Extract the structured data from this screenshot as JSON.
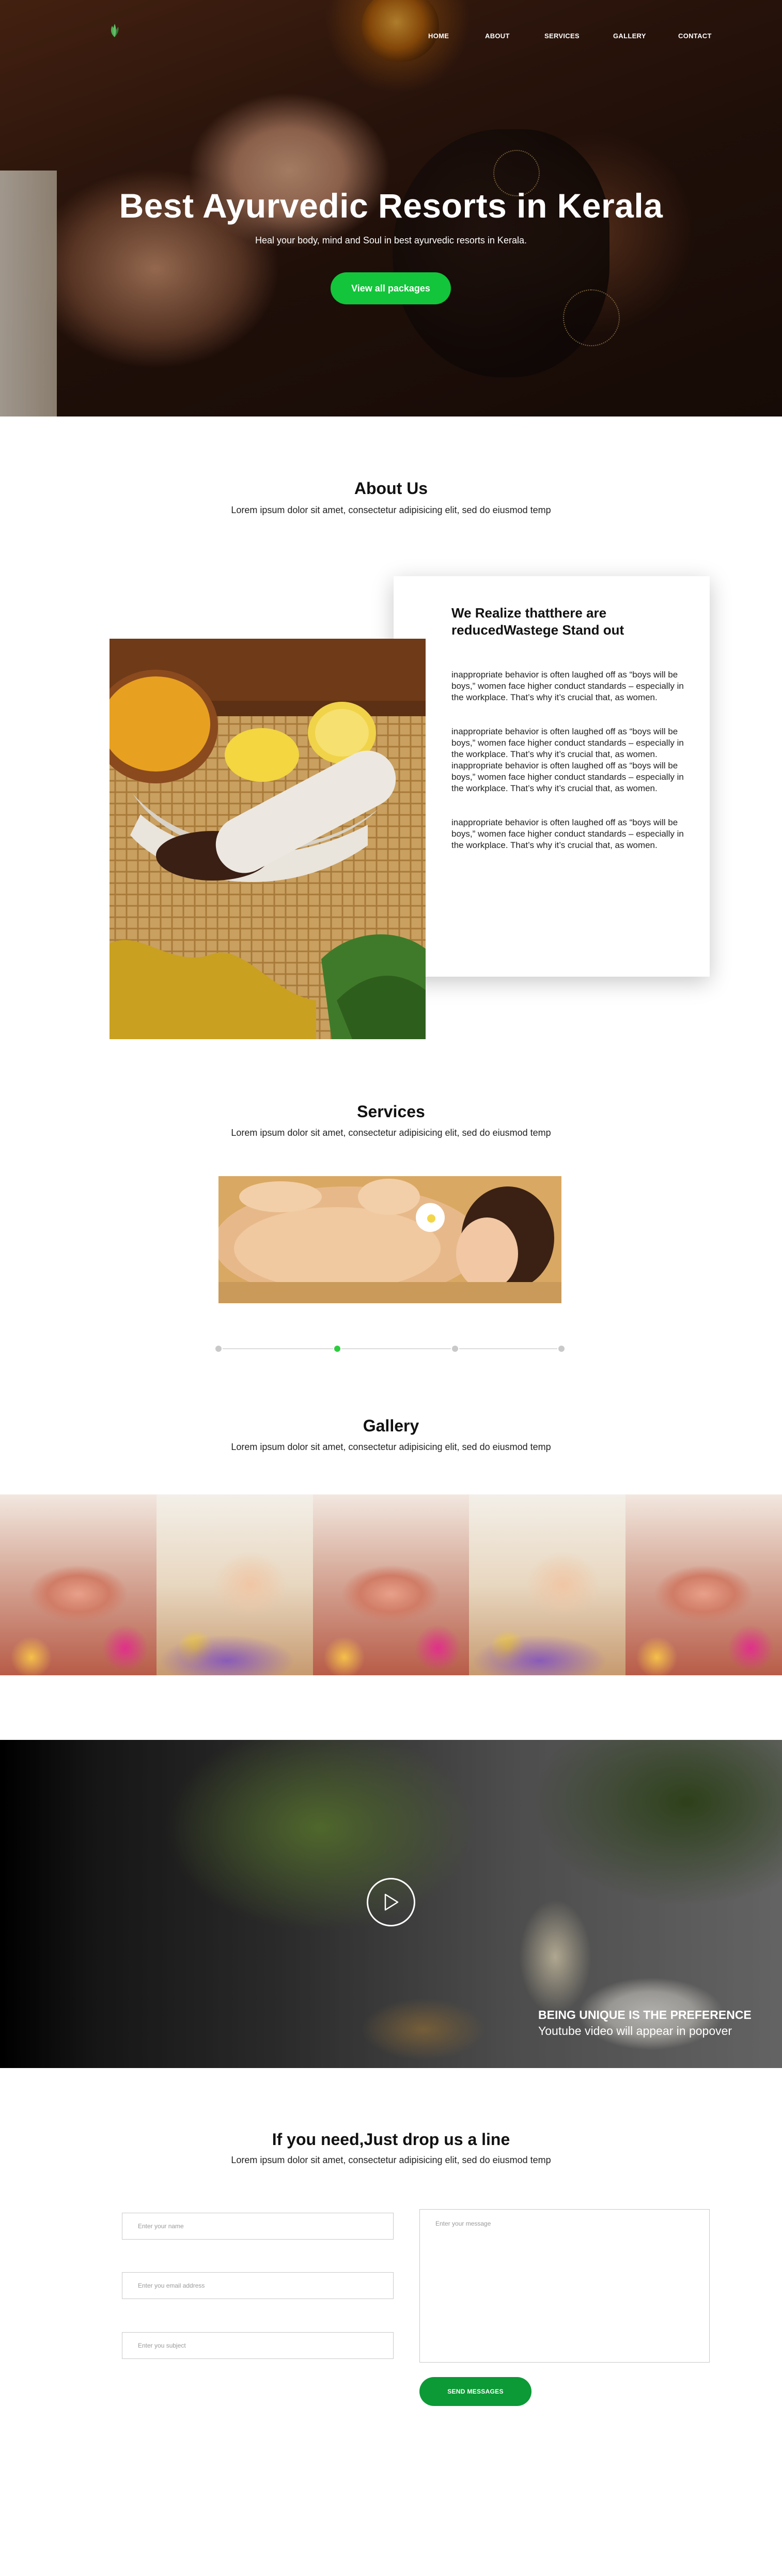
{
  "brand": {
    "accent": "#12c53a",
    "dark_green": "#0c9a36",
    "logo_icon": "leaf-logo-icon"
  },
  "nav": {
    "items": [
      "HOME",
      "ABOUT",
      "SERVICES",
      "GALLERY",
      "CONTACT"
    ]
  },
  "hero": {
    "title": "Best Ayurvedic Resorts in Kerala",
    "subtitle": "Heal your body, mind and Soul in best ayurvedic resorts in Kerala.",
    "button_label": "View all packages"
  },
  "about": {
    "title": "About Us",
    "subtitle": "Lorem ipsum dolor sit amet, consectetur adipisicing elit, sed do eiusmod temp",
    "card_title": "We Realize thatthere are reducedWastege Stand out",
    "paragraphs": [
      "inappropriate behavior is often laughed off as “boys will be boys,” women face higher conduct standards – especially in the workplace. That’s why it’s crucial that, as women.",
      "inappropriate behavior is often laughed off as “boys will be boys,” women face higher conduct standards – especially in the workplace. That’s why it’s crucial that, as women. inappropriate behavior is often laughed off as “boys will be boys,” women face higher conduct standards – especially in the workplace. That’s why it’s crucial that, as women.",
      "inappropriate behavior is often laughed off as “boys will be boys,” women face higher conduct standards – especially in the workplace. That’s why it’s crucial that, as women."
    ]
  },
  "services": {
    "title": "Services",
    "subtitle": "Lorem ipsum dolor sit amet, consectetur adipisicing elit, sed do eiusmod temp",
    "slider_dots": 4,
    "active_dot": 2
  },
  "gallery": {
    "title": "Gallery",
    "subtitle": "Lorem ipsum dolor sit amet, consectetur adipisicing elit, sed do eiusmod temp"
  },
  "video": {
    "play_icon": "play-icon",
    "title": "BEING UNIQUE IS THE PREFERENCE",
    "subtitle": "Youtube video will appear in popover"
  },
  "contact": {
    "title": "If you need,Just drop us a line",
    "subtitle": "Lorem ipsum dolor sit amet, consectetur adipisicing elit, sed do eiusmod temp",
    "name_placeholder": "Enter your name",
    "email_placeholder": "Enter you email address",
    "subject_placeholder": "Enter you subject",
    "message_placeholder": "Enter your message",
    "send_label": "SEND MESSAGES"
  }
}
